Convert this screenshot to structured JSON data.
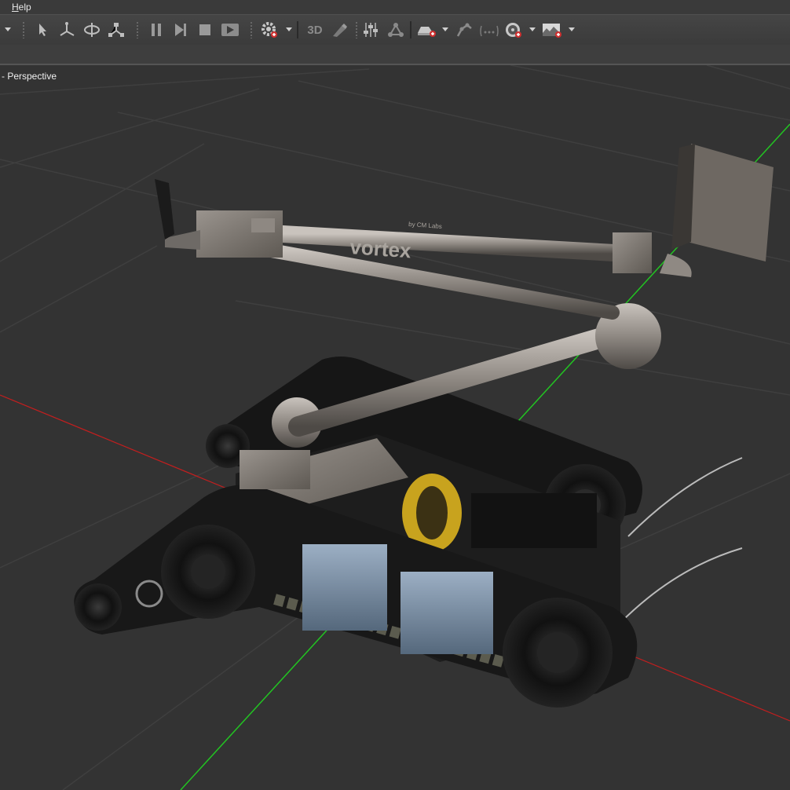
{
  "menubar": {
    "help_prefix": "H",
    "help_rest": "elp"
  },
  "toolbar": {
    "groups": [
      "select-icon",
      "translate-icon",
      "rotate-icon",
      "scale-icon",
      "pause-icon",
      "step-icon",
      "stop-icon",
      "record-icon",
      "settings-gear-icon",
      "3d-view-icon",
      "brush-icon",
      "sliders-icon",
      "graph-icon",
      "vehicle-add-icon",
      "arm-icon",
      "dots-icon",
      "wheel-add-icon",
      "terrain-add-icon"
    ],
    "text_3d": "3D"
  },
  "viewport": {
    "label": "- Perspective"
  },
  "robot": {
    "arm_logo_small": "by CM Labs",
    "arm_logo": "vortex"
  },
  "colors": {
    "grid": "#3d3d3d",
    "x_axis": "#d02020",
    "y_axis": "#20c020",
    "robot_body": "#1c1c1c",
    "arm": "#8a8580"
  }
}
